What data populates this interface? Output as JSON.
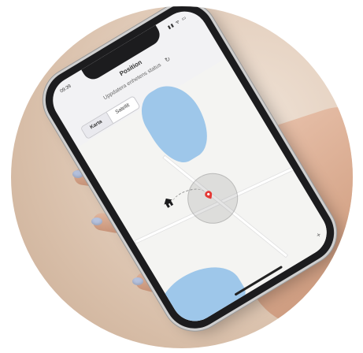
{
  "app": {
    "status_time": "09:39",
    "status_icons": "▮▮ ᯤ ▭"
  },
  "header": {
    "title": "Position",
    "subtitle": "Uppdatera enhetens status",
    "refresh_icon": "refresh-icon"
  },
  "tabs": [
    {
      "label": "Karta",
      "active": true
    },
    {
      "label": "Satellit",
      "active": false
    }
  ],
  "map": {
    "home_icon": "home-icon",
    "pin_icon": "map-pin-icon",
    "water_color": "#9ec7ea",
    "range_color": "#969696"
  },
  "colors": {
    "accent_pin": "#e53935",
    "background": "#ffffff"
  }
}
